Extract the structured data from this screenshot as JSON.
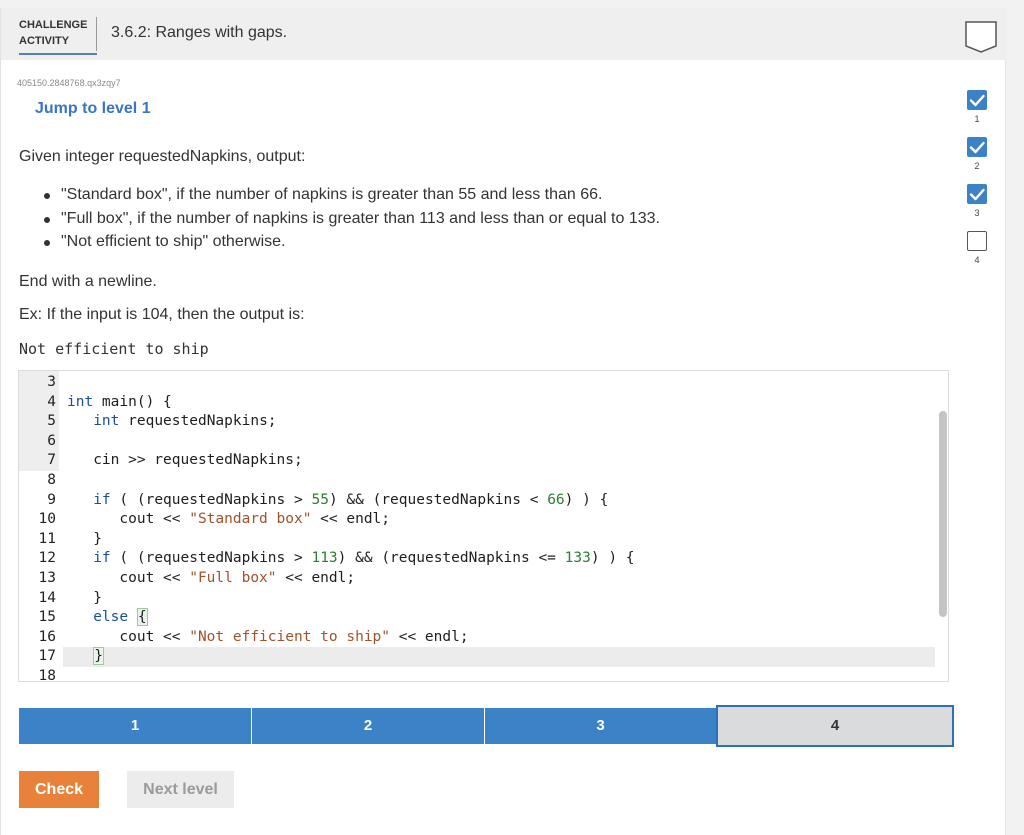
{
  "header": {
    "activity_label_line1": "CHALLENGE",
    "activity_label_line2": "ACTIVITY",
    "title": "3.6.2: Ranges with gaps."
  },
  "activity_id": "405150.2848768.qx3zqy7",
  "jump_link": "Jump to level 1",
  "prompt": {
    "intro": "Given integer requestedNapkins, output:",
    "bullets": [
      "\"Standard box\", if the number of napkins is greater than 55 and less than 66.",
      "\"Full box\", if the number of napkins is greater than 113 and less than or equal to 133.",
      "\"Not efficient to ship\" otherwise."
    ],
    "ending": "End with a newline.",
    "example": "Ex: If the input is 104, then the output is:",
    "example_output": "Not efficient to ship"
  },
  "editor": {
    "line_numbers": [
      "3",
      "4",
      "5",
      "6",
      "7",
      "8",
      "9",
      "10",
      "11",
      "12",
      "13",
      "14",
      "15",
      "16",
      "17",
      "18"
    ],
    "lines": [
      "",
      "int main() {",
      "   int requestedNapkins;",
      "",
      "   cin >> requestedNapkins;",
      "",
      "   if ( (requestedNapkins > 55) && (requestedNapkins < 66) ) {",
      "      cout << \"Standard box\" << endl;",
      "   }",
      "   if ( (requestedNapkins > 113) && (requestedNapkins <= 133) ) {",
      "      cout << \"Full box\" << endl;",
      "   }",
      "   else {",
      "      cout << \"Not efficient to ship\" << endl;",
      "   }",
      ""
    ],
    "active_line_number": "17"
  },
  "levels": {
    "items": [
      "1",
      "2",
      "3",
      "4"
    ],
    "current": "4"
  },
  "buttons": {
    "check": "Check",
    "next_level": "Next level"
  },
  "level_nav": [
    {
      "number": "1",
      "status": "completed"
    },
    {
      "number": "2",
      "status": "completed"
    },
    {
      "number": "3",
      "status": "completed"
    },
    {
      "number": "4",
      "status": "incomplete"
    }
  ],
  "colors": {
    "accent_blue": "#3b82c7",
    "link_blue": "#3a74c4",
    "check_orange": "#e8823a"
  }
}
